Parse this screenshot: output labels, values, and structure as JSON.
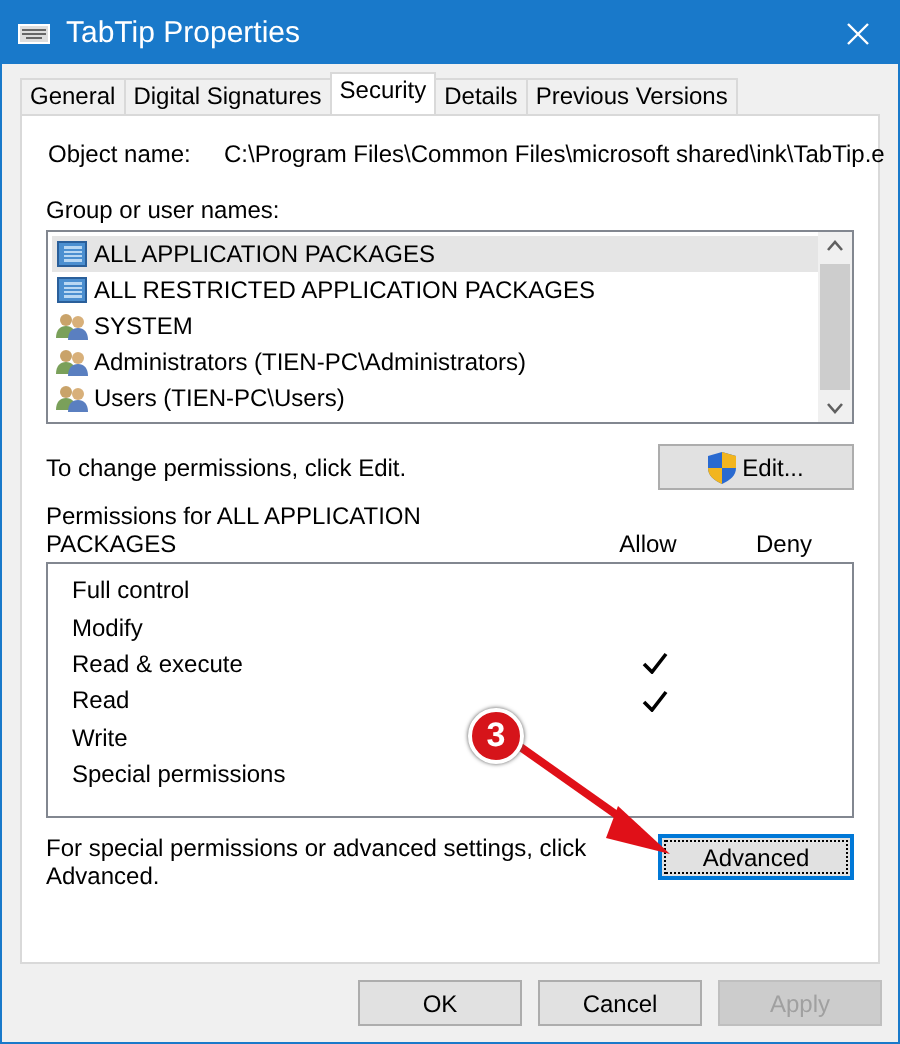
{
  "window": {
    "title": "TabTip Properties"
  },
  "tabs": [
    {
      "label": "General",
      "selected": false
    },
    {
      "label": "Digital Signatures",
      "selected": false
    },
    {
      "label": "Security",
      "selected": true
    },
    {
      "label": "Details",
      "selected": false
    },
    {
      "label": "Previous Versions",
      "selected": false
    }
  ],
  "object_name": {
    "label": "Object name:",
    "value": "C:\\Program Files\\Common Files\\microsoft shared\\ink\\TabTip.e"
  },
  "groups": {
    "label": "Group or user names:",
    "items": [
      {
        "name": "ALL APPLICATION PACKAGES",
        "kind": "package",
        "selected": true
      },
      {
        "name": "ALL RESTRICTED APPLICATION PACKAGES",
        "kind": "package",
        "selected": false
      },
      {
        "name": "SYSTEM",
        "kind": "users",
        "selected": false
      },
      {
        "name": "Administrators (TIEN-PC\\Administrators)",
        "kind": "users",
        "selected": false
      },
      {
        "name": "Users (TIEN-PC\\Users)",
        "kind": "users",
        "selected": false
      }
    ]
  },
  "edit_hint": "To change permissions, click Edit.",
  "edit_button": "Edit...",
  "permissions": {
    "label": "Permissions for ALL APPLICATION PACKAGES",
    "allow_header": "Allow",
    "deny_header": "Deny",
    "rows": [
      {
        "name": "Full control",
        "allow": false,
        "deny": false
      },
      {
        "name": "Modify",
        "allow": false,
        "deny": false
      },
      {
        "name": "Read & execute",
        "allow": true,
        "deny": false
      },
      {
        "name": "Read",
        "allow": true,
        "deny": false
      },
      {
        "name": "Write",
        "allow": false,
        "deny": false
      },
      {
        "name": "Special permissions",
        "allow": false,
        "deny": false
      }
    ]
  },
  "advanced_hint": "For special permissions or advanced settings, click Advanced.",
  "advanced_button": {
    "label": "Advanced",
    "focused": true
  },
  "annotation": {
    "label": "3"
  },
  "buttons": [
    {
      "label": "OK",
      "disabled": false
    },
    {
      "label": "Cancel",
      "disabled": false
    },
    {
      "label": "Apply",
      "disabled": true
    }
  ]
}
